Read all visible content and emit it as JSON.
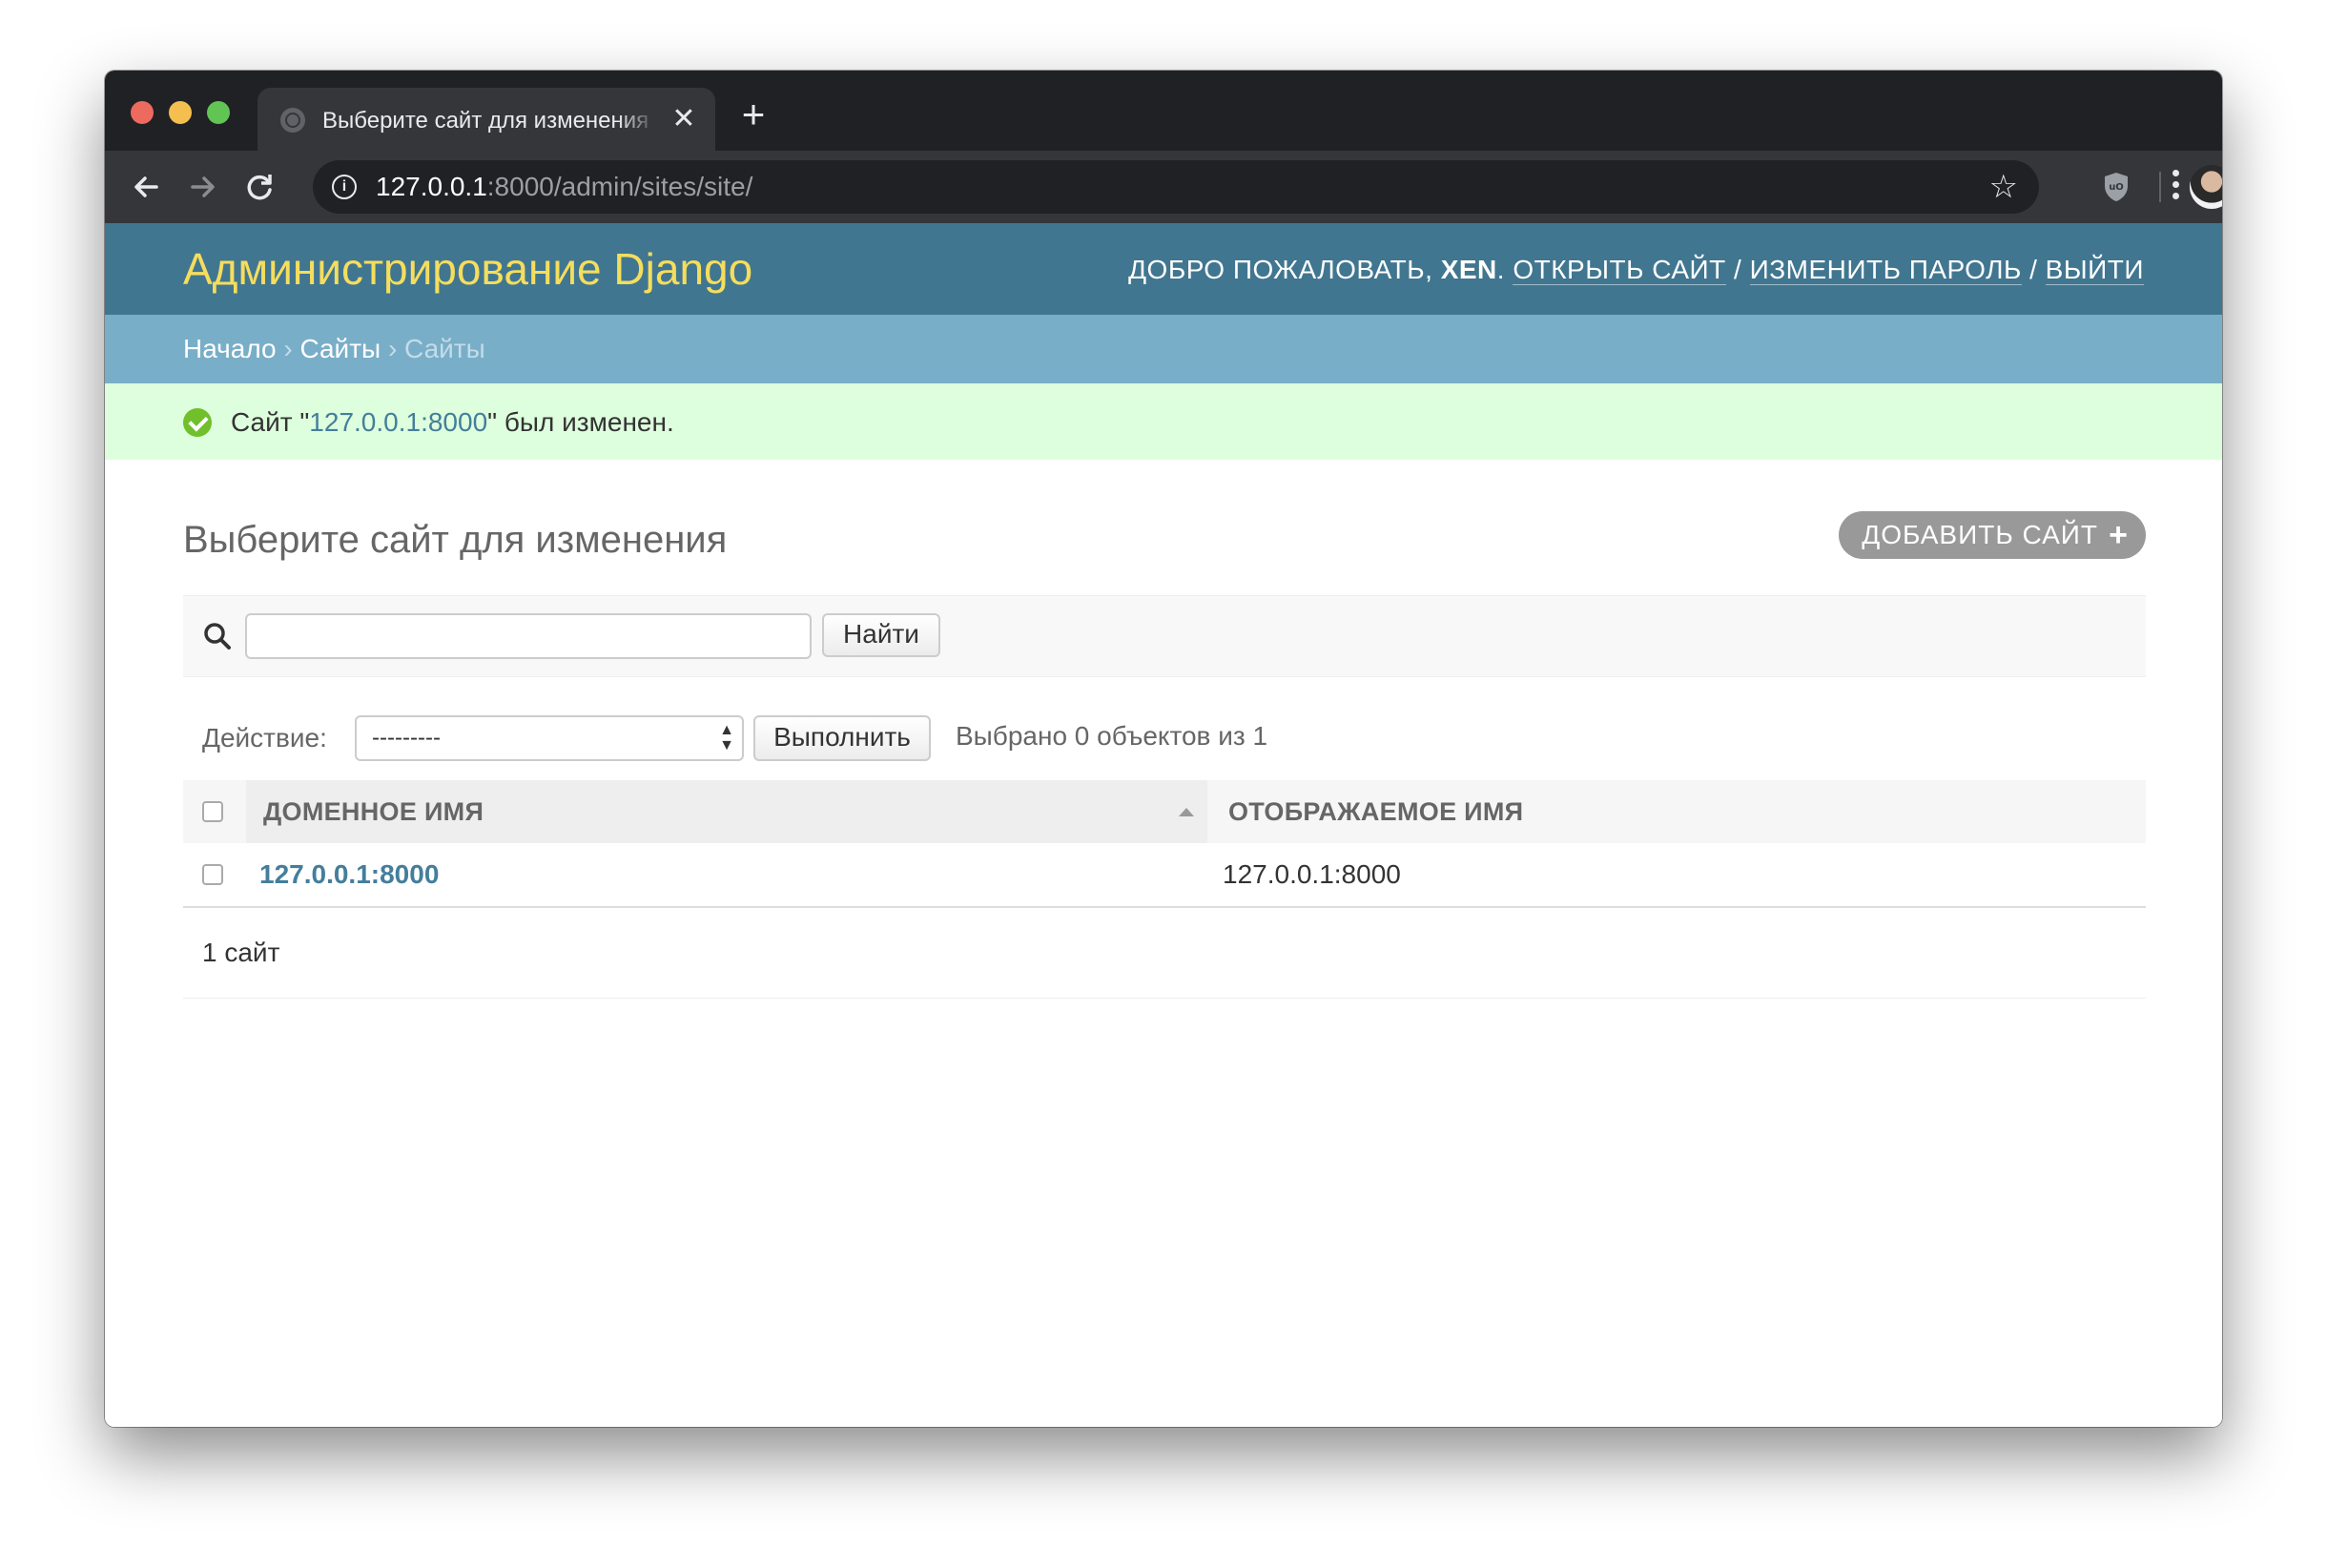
{
  "browser": {
    "tab_title": "Выберите сайт для изменения",
    "url_host": "127.0.0.1",
    "url_rest": ":8000/admin/sites/site/",
    "new_tab_glyph": "+",
    "close_glyph": "✕"
  },
  "header": {
    "branding": "Администрирование Django",
    "welcome": "Добро пожаловать,",
    "username": "xen",
    "view_site": "Открыть сайт",
    "change_password": "Изменить пароль",
    "logout": "Выйти"
  },
  "breadcrumbs": {
    "home": "Начало",
    "app": "Сайты",
    "current": "Сайты",
    "sep": "›"
  },
  "message": {
    "prefix": "Сайт \"",
    "object": "127.0.0.1:8000",
    "suffix": "\" был изменен."
  },
  "content": {
    "title": "Выберите сайт для изменения",
    "add_button": "Добавить сайт",
    "add_glyph": "+"
  },
  "search": {
    "value": "",
    "button": "Найти"
  },
  "actions": {
    "label": "Действие:",
    "selected_option": "---------",
    "go_button": "Выполнить",
    "counter": "Выбрано 0 объектов из 1"
  },
  "table": {
    "columns": [
      "Доменное имя",
      "Отображаемое имя"
    ],
    "sort": "ascending",
    "rows": [
      {
        "domain": "127.0.0.1:8000",
        "display": "127.0.0.1:8000",
        "checked": false
      }
    ]
  },
  "paginator": {
    "text": "1 сайт"
  },
  "colors": {
    "header_bg": "#417690",
    "branding": "#f5dd5d",
    "breadcrumbs_bg": "#79aec8",
    "success_bg": "#ddffdd",
    "link": "#447e9b"
  }
}
